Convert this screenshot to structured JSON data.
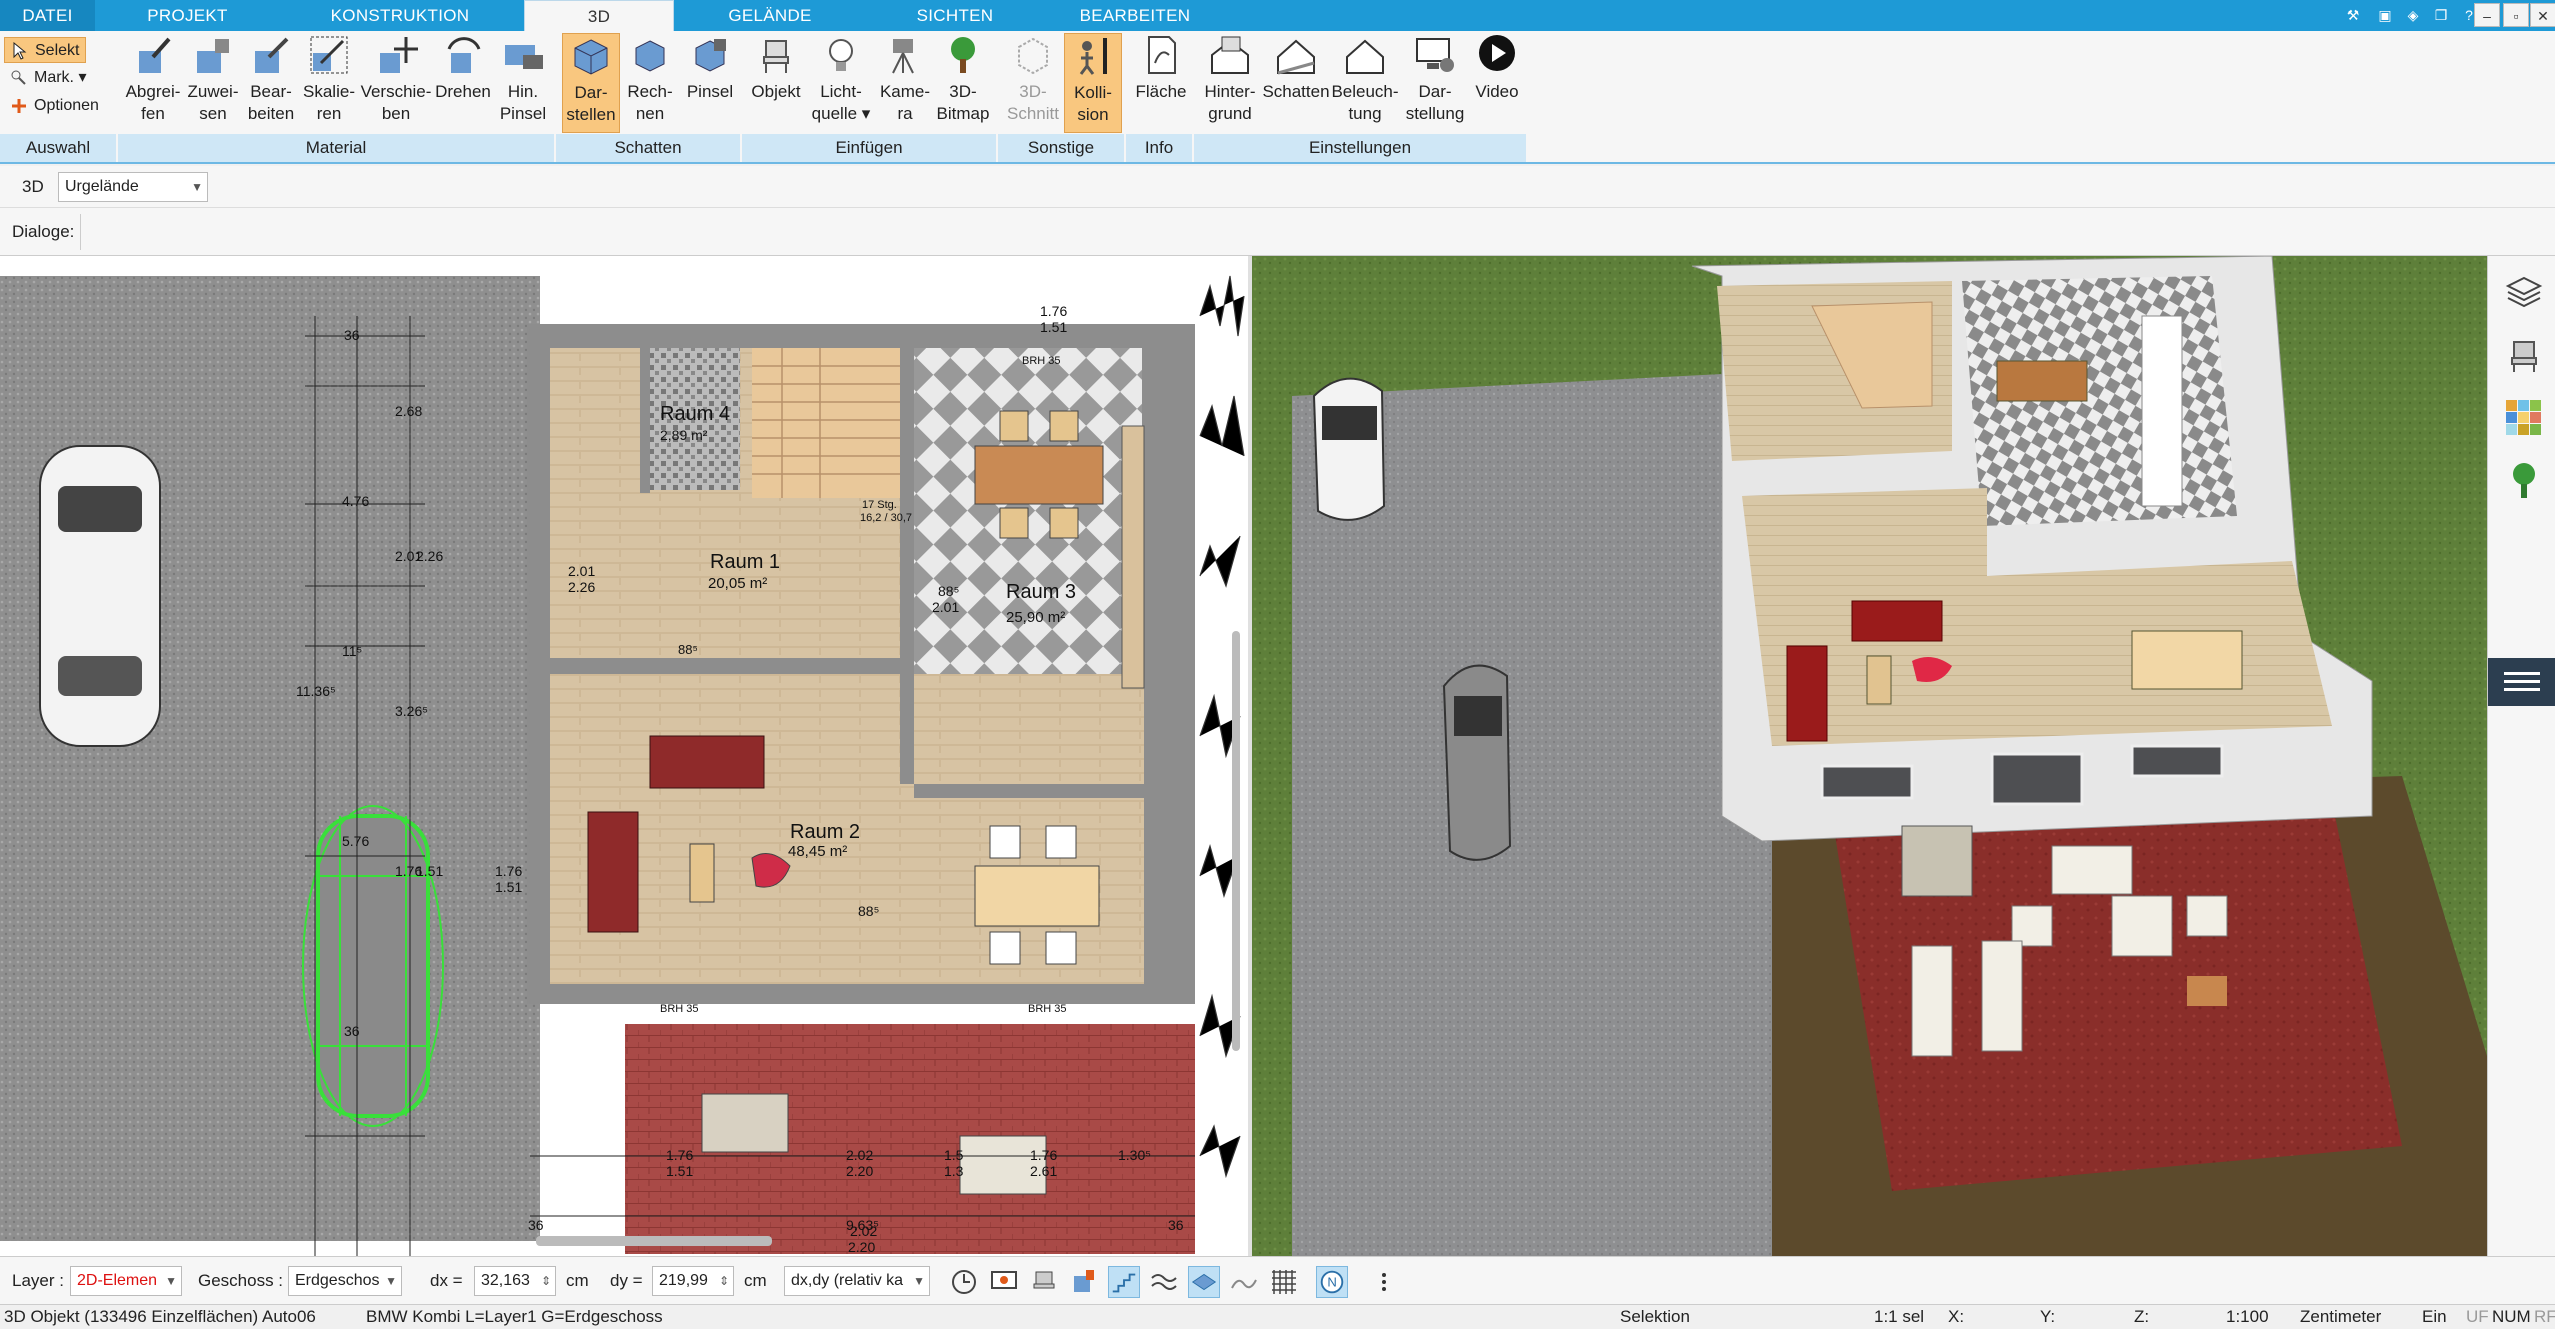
{
  "tabs": [
    "DATEI",
    "PROJEKT",
    "KONSTRUKTION",
    "3D",
    "GELÄNDE",
    "SICHTEN",
    "BEARBEITEN"
  ],
  "active_tab": "3D",
  "ribbon": {
    "auswahl": {
      "selekt": "Selekt",
      "mark": "Mark.",
      "optionen": "Optionen",
      "group": "Auswahl"
    },
    "material": {
      "group": "Material",
      "buttons": [
        {
          "l1": "Abgrei-",
          "l2": "fen"
        },
        {
          "l1": "Zuwei-",
          "l2": "sen"
        },
        {
          "l1": "Bear-",
          "l2": "beiten"
        },
        {
          "l1": "Skalie-",
          "l2": "ren"
        },
        {
          "l1": "Verschie-",
          "l2": "ben"
        },
        {
          "l1": "Drehen",
          "l2": ""
        },
        {
          "l1": "Hin.",
          "l2": "Pinsel"
        }
      ]
    },
    "schatten": {
      "group": "Schatten",
      "buttons": [
        {
          "l1": "Dar-",
          "l2": "stellen"
        },
        {
          "l1": "Rech-",
          "l2": "nen"
        },
        {
          "l1": "Pinsel",
          "l2": ""
        }
      ]
    },
    "einfuegen": {
      "group": "Einfügen",
      "buttons": [
        {
          "l1": "Objekt",
          "l2": ""
        },
        {
          "l1": "Licht-",
          "l2": "quelle ▾"
        },
        {
          "l1": "Kame-",
          "l2": "ra"
        },
        {
          "l1": "3D-",
          "l2": "Bitmap"
        }
      ]
    },
    "sonstige": {
      "group": "Sonstige",
      "buttons": [
        {
          "l1": "3D-",
          "l2": "Schnitt"
        },
        {
          "l1": "Kolli-",
          "l2": "sion"
        }
      ]
    },
    "info": {
      "group": "Info",
      "buttons": [
        {
          "l1": "Fläche",
          "l2": ""
        }
      ]
    },
    "einstellungen": {
      "group": "Einstellungen",
      "buttons": [
        {
          "l1": "Hinter-",
          "l2": "grund"
        },
        {
          "l1": "Schatten",
          "l2": ""
        },
        {
          "l1": "Beleuch-",
          "l2": "tung"
        },
        {
          "l1": "Dar-",
          "l2": "stellung"
        },
        {
          "l1": "Video",
          "l2": ""
        }
      ]
    }
  },
  "row2": {
    "mode": "3D",
    "terrain_select": "Urgelände"
  },
  "row3": {
    "dialoge_label": "Dialoge:"
  },
  "plan": {
    "rooms": [
      {
        "name": "Raum 4",
        "area": "2,89 m²"
      },
      {
        "name": "Raum 1",
        "area": "20,05 m²"
      },
      {
        "name": "Raum 3",
        "area": "25,90 m²"
      },
      {
        "name": "Raum 2",
        "area": "48,45 m²"
      }
    ],
    "stairs_note": "17 Stg.",
    "stairs_dim": "16,2 / 30,7",
    "labels": {
      "brh35": "BRH 35",
      "d176": "1.76",
      "d151": "1.51",
      "d36": "36",
      "d268": "2.68",
      "d476": "4.76",
      "d201": "2.01",
      "d226": "2.26",
      "d1136": "11.36⁵",
      "d326": "3.26⁵",
      "d11": "11⁵",
      "d576": "5.76",
      "d88": "88⁵",
      "d202": "2.02",
      "d220": "2.20",
      "d963": "9.63⁵",
      "d130": "1.30⁵",
      "d15": "1.5",
      "d13": "1.3",
      "d261": "2.61"
    }
  },
  "sidebar": {
    "icons": [
      "layers-icon",
      "chair-icon",
      "materials-icon",
      "tree-icon",
      "menu-icon"
    ]
  },
  "bottom": {
    "layer_label": "Layer :",
    "layer_value": "2D-Elemen",
    "geschoss_label": "Geschoss :",
    "geschoss_value": "Erdgeschos",
    "dx_label": "dx =",
    "dx_value": "32,163",
    "dx_unit": "cm",
    "dy_label": "dy =",
    "dy_value": "219,99",
    "dy_unit": "cm",
    "mode_value": "dx,dy (relativ ka"
  },
  "status": {
    "object": "3D Objekt (133496 Einzelflächen) Auto06",
    "car": "BMW Kombi L=Layer1 G=Erdgeschoss",
    "mode": "Selektion",
    "sel": "1:1 sel",
    "x": "X:",
    "y": "Y:",
    "z": "Z:",
    "scale": "1:100",
    "unit": "Zentimeter",
    "ein": "Ein",
    "uf": "UF",
    "num": "NUM",
    "rf": "RF"
  },
  "colors": {
    "tabbar": "#1e9ad6",
    "ribbon_group": "#cfe7f6",
    "selected_button": "#f9c77f",
    "paving": "#9a9a9a",
    "lawn": "#5e7f3a",
    "terrace": "#8a2e2a",
    "car_selected": "#39e03a"
  }
}
